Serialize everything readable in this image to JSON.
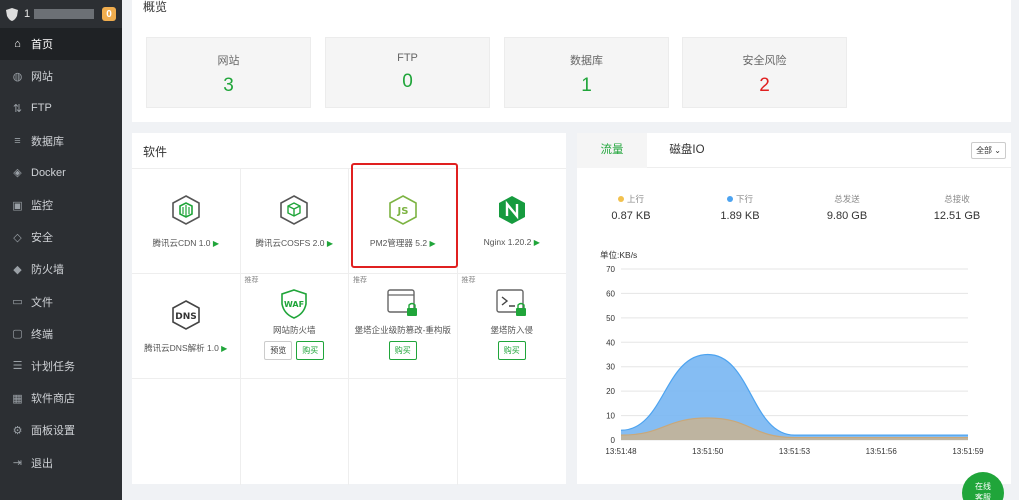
{
  "sidebar": {
    "user": "1",
    "badge": "0",
    "items": [
      {
        "label": "首页",
        "icon": "home-icon"
      },
      {
        "label": "网站",
        "icon": "globe-icon"
      },
      {
        "label": "FTP",
        "icon": "ftp-icon"
      },
      {
        "label": "数据库",
        "icon": "database-icon"
      },
      {
        "label": "Docker",
        "icon": "docker-icon"
      },
      {
        "label": "监控",
        "icon": "monitor-icon"
      },
      {
        "label": "安全",
        "icon": "security-icon"
      },
      {
        "label": "防火墙",
        "icon": "firewall-icon"
      },
      {
        "label": "文件",
        "icon": "folder-icon"
      },
      {
        "label": "终端",
        "icon": "terminal-icon"
      },
      {
        "label": "计划任务",
        "icon": "cron-icon"
      },
      {
        "label": "软件商店",
        "icon": "store-icon"
      },
      {
        "label": "面板设置",
        "icon": "settings-icon"
      },
      {
        "label": "退出",
        "icon": "logout-icon"
      }
    ]
  },
  "overview": {
    "title": "概览",
    "boxes": [
      {
        "label": "网站",
        "value": "3"
      },
      {
        "label": "FTP",
        "value": "0"
      },
      {
        "label": "数据库",
        "value": "1"
      },
      {
        "label": "安全风险",
        "value": "2"
      }
    ]
  },
  "software": {
    "title": "软件",
    "items": [
      {
        "name": "腾讯云CDN 1.0",
        "icon": "tencent-cdn-icon"
      },
      {
        "name": "腾讯云COSFS 2.0",
        "icon": "tencent-cosfs-icon"
      },
      {
        "name": "PM2管理器 5.2",
        "icon": "nodejs-icon"
      },
      {
        "name": "Nginx 1.20.2",
        "icon": "nginx-icon"
      },
      {
        "name": "腾讯云DNS解析 1.0",
        "icon": "dns-icon"
      },
      {
        "name": "网站防火墙",
        "tag": "推荐",
        "icon": "waf-icon",
        "btn1": "预览",
        "btn2": "购买"
      },
      {
        "name": "堡塔企业级防篡改-重构版",
        "tag": "推荐",
        "icon": "tamper-proof-icon",
        "btn2": "购买"
      },
      {
        "name": "堡塔防入侵",
        "tag": "推荐",
        "icon": "intrusion-icon",
        "btn2": "购买"
      }
    ]
  },
  "traffic": {
    "tab1": "流量",
    "tab2": "磁盘IO",
    "select": "全部",
    "stats": [
      {
        "label": "上行",
        "value": "0.87 KB",
        "color": "#f2c14e"
      },
      {
        "label": "下行",
        "value": "1.89 KB",
        "color": "#4ca3f0"
      },
      {
        "label": "总发送",
        "value": "9.80 GB"
      },
      {
        "label": "总接收",
        "value": "12.51 GB"
      }
    ],
    "unit": "单位:KB/s"
  },
  "chart_data": {
    "type": "area",
    "ylabel": "单位:KB/s",
    "ylim": [
      0,
      70
    ],
    "yticks": [
      0,
      10,
      20,
      30,
      40,
      50,
      60,
      70
    ],
    "x": [
      "13:51:48",
      "13:51:50",
      "13:51:53",
      "13:51:56",
      "13:51:59"
    ],
    "series": [
      {
        "name": "下行",
        "color": "#4ca3f0",
        "values": [
          4,
          35,
          2,
          2,
          2
        ]
      },
      {
        "name": "上行",
        "color": "#c9a87a",
        "values": [
          2,
          9,
          1,
          1,
          1
        ]
      }
    ]
  },
  "chat": {
    "line1": "在线",
    "line2": "客服"
  }
}
